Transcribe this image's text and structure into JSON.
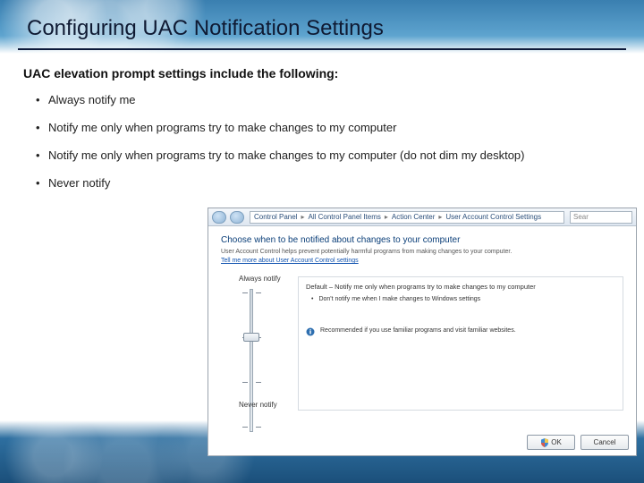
{
  "title": "Configuring UAC Notification Settings",
  "subhead": "UAC elevation prompt settings include the following:",
  "bullets": [
    "Always notify me",
    "Notify me only when programs try to make changes to my computer",
    "Notify me only when programs try to make changes to my computer (do not dim my desktop)",
    "Never notify"
  ],
  "screenshot": {
    "breadcrumbs": [
      "Control Panel",
      "All Control Panel Items",
      "Action Center",
      "User Account Control Settings"
    ],
    "search_placeholder": "Sear",
    "heading": "Choose when to be notified about changes to your computer",
    "description": "User Account Control helps prevent potentially harmful programs from making changes to your computer.",
    "link_text": "Tell me more about User Account Control settings",
    "slider_top": "Always notify",
    "slider_bottom": "Never notify",
    "default_heading": "Default – Notify me only when programs try to make changes to my computer",
    "detail_item": "Don't notify me when I make changes to Windows settings",
    "recommendation": "Recommended if you use familiar programs and visit familiar websites.",
    "ok_label": "OK",
    "cancel_label": "Cancel"
  }
}
